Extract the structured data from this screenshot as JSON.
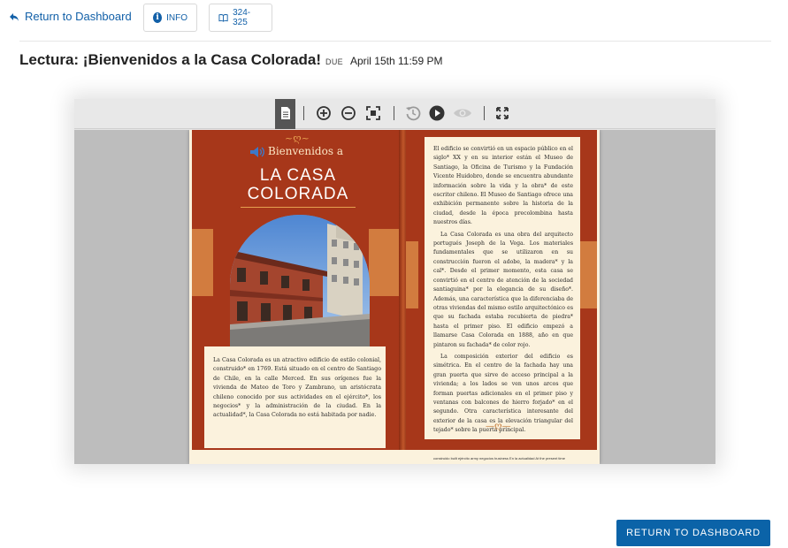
{
  "nav": {
    "back_label": "Return to Dashboard",
    "info_label": "INFO",
    "pages_label": "324-325"
  },
  "assignment": {
    "title": "Lectura: ¡Bienvenidos a la Casa Colorada!",
    "due_label": "DUE",
    "due_value": "April 15th 11:59 PM"
  },
  "viewer": {
    "toolbar_icons": [
      "page-icon",
      "zoom-in-icon",
      "zoom-out-icon",
      "fit-page-icon",
      "history-icon",
      "play-icon",
      "eye-icon",
      "fullscreen-icon"
    ]
  },
  "book": {
    "left": {
      "heading_small": "Bienvenidos a",
      "heading_line1": "LA CASA",
      "heading_line2": "COLORADA",
      "caption": "La Casa Colorada es un atractivo edificio de estilo colonial, construido* en 1769. Está situado en el centro de Santiago de Chile, en la calle Merced. En sus orígenes fue la vivienda de Mateo de Toro y Zambrano, un aristócrata chileno conocido por sus actividades en el ejército*, los negocios* y la administración de la ciudad. En la actualidad*, la Casa Colorada no está habitada por nadie."
    },
    "right": {
      "p1": "El edificio se convirtió en un espacio público en el siglo* XX y en su interior están el Museo de Santiago, la Oficina de Turismo y la Fundación Vicente Huidobro, donde se encuentra abundante información sobre la vida y la obra* de este escritor chileno. El Museo de Santiago ofrece una exhibición permanente sobre la historia de la ciudad, desde la época precolombina hasta nuestros días.",
      "p2": "La Casa Colorada es una obra del arquitecto portugués Joseph de la Vega. Los materiales fundamentales que se utilizaron en su construcción fueron el adobe, la madera* y la cal*. Desde el primer momento, esta casa se convirtió en el centro de atención de la sociedad santiaguina* por la elegancia de su diseño*. Además, una característica que la diferenciaba de otras viviendas del mismo estilo arquitectónico es que su fachada estaba recubierta de piedra* hasta el primer piso. El edificio empezó a llamarse Casa Colorada en 1888, año en que pintaron su fachada* de color rojo.",
      "p3": "La composición exterior del edificio es simétrica. En el centro de la fachada hay una gran puerta que sirve de acceso principal a la vivienda; a los lados se ven unos arcos que forman puertas adicionales en el primer piso y ventanas con balcones de hierro forjado* en el segundo. Otra característica interesante del exterior de la casa es la elevación triangular del tejado* sobre la puerta principal."
    },
    "glossary": "construido built   ejército army   negocios business   En la actualidad At the present time"
  },
  "footer": {
    "return_button": "RETURN TO DASHBOARD"
  },
  "colors": {
    "link_blue": "#1260a8",
    "button_blue": "#0b63a8",
    "page_red": "#a7371a",
    "band_orange": "#d27c3f",
    "parchment": "#fbf2dd"
  }
}
